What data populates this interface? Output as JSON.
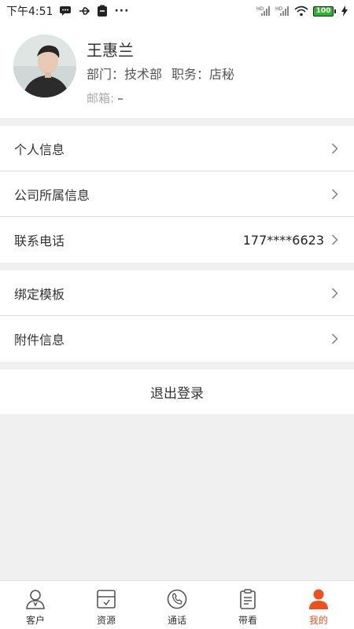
{
  "status_bar": {
    "time": "下午4:51",
    "dots": "···",
    "battery": "100",
    "icons": [
      "message-icon",
      "usb-icon",
      "clipboard-icon",
      "signal-hd-icon",
      "signal-hd-icon",
      "wifi-icon",
      "battery-icon",
      "charging-icon"
    ]
  },
  "profile": {
    "name": "王惠兰",
    "dept_label": "部门：",
    "dept_value": "技术部",
    "role_label": "职务：",
    "role_value": "店秘",
    "email_label": "邮箱:",
    "email_value": "–"
  },
  "menu_group_1": [
    {
      "label": "个人信息",
      "value": ""
    },
    {
      "label": "公司所属信息",
      "value": ""
    },
    {
      "label": "联系电话",
      "value": "177****6623"
    }
  ],
  "menu_group_2": [
    {
      "label": "绑定模板",
      "value": ""
    },
    {
      "label": "附件信息",
      "value": ""
    }
  ],
  "logout_label": "退出登录",
  "tabs": [
    {
      "label": "客户",
      "icon": "customer-icon"
    },
    {
      "label": "资源",
      "icon": "resource-icon"
    },
    {
      "label": "通话",
      "icon": "phone-icon"
    },
    {
      "label": "带看",
      "icon": "viewing-icon"
    },
    {
      "label": "我的",
      "icon": "profile-icon",
      "active": true
    }
  ],
  "colors": {
    "accent": "#f0501e",
    "background": "#f0f0f0",
    "battery": "#2bb52b"
  }
}
